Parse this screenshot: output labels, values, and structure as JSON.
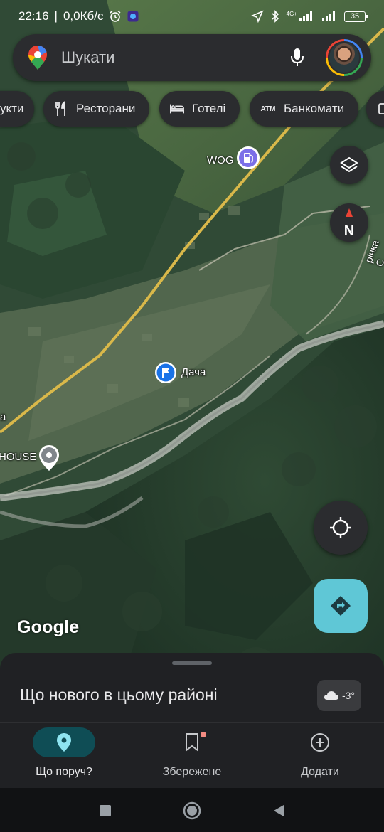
{
  "status_bar": {
    "time": "22:16",
    "speed": "0,0Кб/с",
    "network": "4G+",
    "battery": "35"
  },
  "search": {
    "placeholder": "Шукати"
  },
  "chips": [
    {
      "label": "укти",
      "icon": "bag-icon"
    },
    {
      "label": "Ресторани",
      "icon": "fork-knife-icon"
    },
    {
      "label": "Готелі",
      "icon": "bed-icon"
    },
    {
      "label": "Банкомати",
      "icon": "atm-icon",
      "icon_text": "ATM"
    },
    {
      "label": "",
      "icon": "more-icon"
    }
  ],
  "map": {
    "labels": {
      "wog": "WOG",
      "dacha": "Дача",
      "house": "HOUSE",
      "left_edge": "а",
      "river": "річка С"
    },
    "compass": "N",
    "google": "Google"
  },
  "sheet": {
    "title": "Що нового в цьому районі",
    "weather": "-3°"
  },
  "bottom_nav": [
    {
      "label": "Що поруч?",
      "icon": "explore-pin-icon",
      "active": true
    },
    {
      "label": "Збережене",
      "icon": "bookmark-icon",
      "active": false,
      "badge": true
    },
    {
      "label": "Додати",
      "icon": "add-circle-icon",
      "active": false
    }
  ],
  "colors": {
    "accent": "#5fc7d6",
    "active_nav_bg": "#0f4d55",
    "dark_surface": "#2b2c2f"
  }
}
